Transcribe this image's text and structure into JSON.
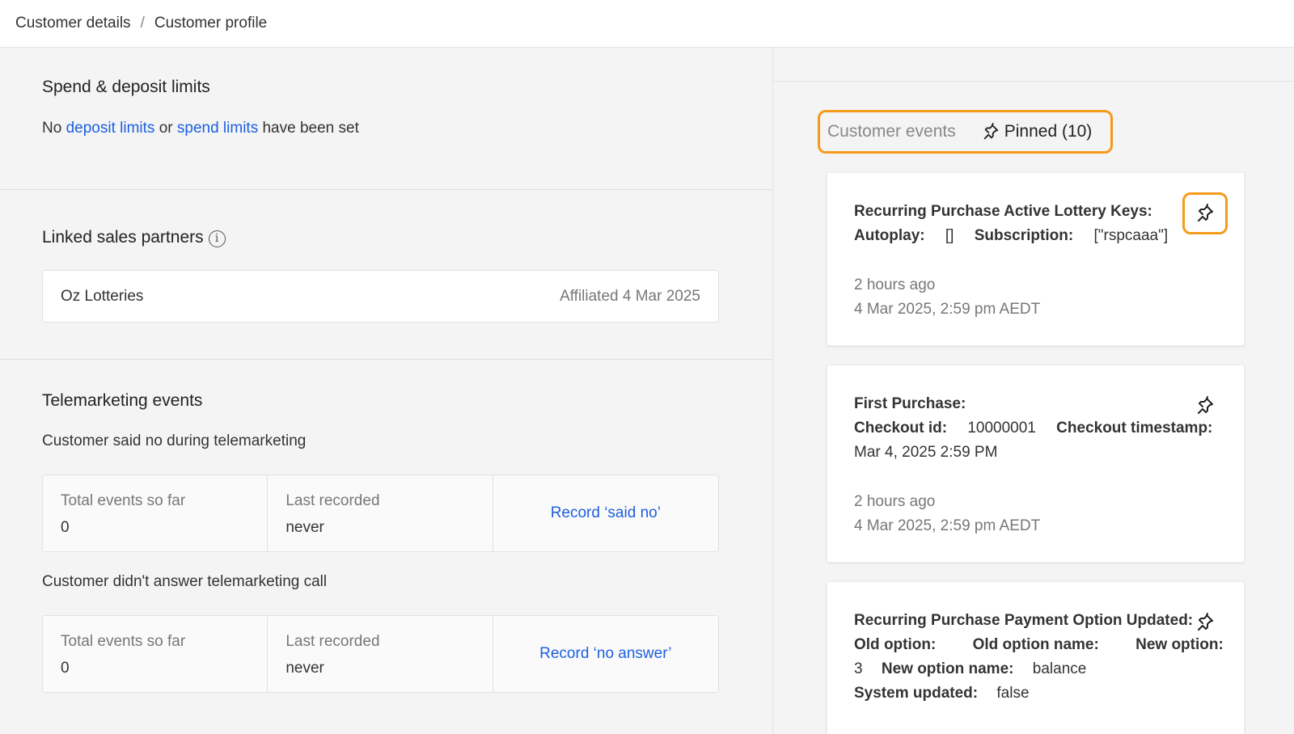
{
  "breadcrumb": {
    "parent": "Customer details",
    "separator": "/",
    "current": "Customer profile"
  },
  "limits": {
    "title": "Spend & deposit limits",
    "prefix": "No",
    "deposit_link": "deposit limits",
    "middle": "or",
    "spend_link": "spend limits",
    "suffix": "have been set"
  },
  "partners": {
    "title": "Linked sales partners",
    "info_glyph": "i",
    "items": [
      {
        "name": "Oz Lotteries",
        "affiliated": "Affiliated 4 Mar 2025"
      }
    ]
  },
  "telemarketing": {
    "title": "Telemarketing events",
    "groups": [
      {
        "heading": "Customer said no during telemarketing",
        "total_label": "Total events so far",
        "total_value": "0",
        "last_label": "Last recorded",
        "last_value": "never",
        "action": "Record ‘said no’"
      },
      {
        "heading": "Customer didn't answer telemarketing call",
        "total_label": "Total events so far",
        "total_value": "0",
        "last_label": "Last recorded",
        "last_value": "never",
        "action": "Record ‘no answer’"
      }
    ]
  },
  "events_panel": {
    "tab_events": "Customer events",
    "tab_pinned": "Pinned (10)",
    "highlight_color": "#f59a1b",
    "link_color": "#1d5fe0",
    "cards": [
      {
        "title": "Recurring Purchase Active Lottery Keys:",
        "lines": [
          [
            [
              "k",
              "Autoplay:"
            ],
            [
              "v",
              "[]"
            ],
            [
              "k",
              "Subscription:"
            ],
            [
              "v",
              "[\"rspcaaa\"]"
            ]
          ]
        ],
        "relative": "2 hours ago",
        "timestamp": "4 Mar 2025, 2:59 pm AEDT"
      },
      {
        "title": "First Purchase:",
        "lines": [
          [
            [
              "k",
              "Checkout id:"
            ],
            [
              "v",
              "10000001"
            ],
            [
              "k",
              "Checkout timestamp:"
            ]
          ],
          [
            [
              "v",
              "Mar 4, 2025 2:59 PM"
            ]
          ]
        ],
        "relative": "2 hours ago",
        "timestamp": "4 Mar 2025, 2:59 pm AEDT"
      },
      {
        "title": "Recurring Purchase Payment Option Updated:",
        "lines": [
          [
            [
              "k",
              "Old option:"
            ],
            [
              "k",
              "Old option name:"
            ],
            [
              "k",
              "New option:"
            ]
          ],
          [
            [
              "v",
              "3"
            ],
            [
              "k",
              "New option name:"
            ],
            [
              "v",
              "balance"
            ]
          ],
          [
            [
              "k",
              "System updated:"
            ],
            [
              "v",
              "false"
            ]
          ]
        ],
        "relative": "",
        "timestamp": ""
      }
    ]
  }
}
